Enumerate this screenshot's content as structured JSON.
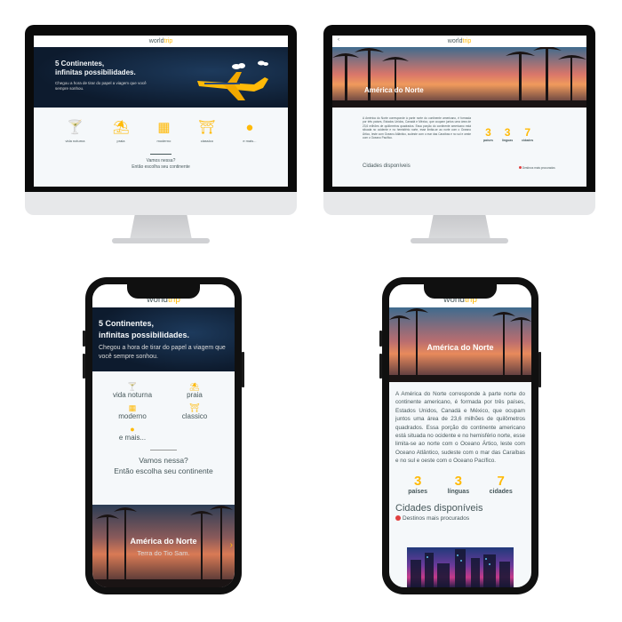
{
  "brand": {
    "logo_main": "world",
    "logo_accent": "trip",
    "accent_color": "#ffba08",
    "text_color": "#47585b",
    "bg_color": "#f5f8fa"
  },
  "banner": {
    "heading_line1": "5 Continentes,",
    "heading_line2": "infinitas possibilidades.",
    "subtitle": "Chegou a hora de tirar do papel a viagem que você sempre sonhou."
  },
  "travel_types": [
    {
      "label": "vida noturna",
      "icon": "cocktail-icon"
    },
    {
      "label": "praia",
      "icon": "beach-icon"
    },
    {
      "label": "moderno",
      "icon": "building-icon"
    },
    {
      "label": "classico",
      "icon": "museum-icon"
    },
    {
      "label": "e mais...",
      "icon": "earth-icon"
    }
  ],
  "cta": {
    "line1": "Vamos nessa?",
    "line2": "Então escolha seu continente"
  },
  "continent_card": {
    "name": "América do Norte",
    "subtitle": "Terra do Tio Sam."
  },
  "continent_page": {
    "name": "América do Norte",
    "description": "A América do Norte corresponde à parte norte do continente americano, é formada por três países, Estados Unidos, Canadá e México, que ocupam juntos uma área de 23,6 milhões de quilômetros quadrados. Essa porção do continente americano está situada no ocidente e no hemisfério norte, esse limita-se ao norte com o Oceano Ártico, leste com Oceano Atlântico, sudeste com o mar das Caraíbas e no sul e oeste com o Oceano Pacífico.",
    "stats": [
      {
        "value": "3",
        "label": "países"
      },
      {
        "value": "3",
        "label": "línguas"
      },
      {
        "value": "7",
        "label": "cidades"
      }
    ],
    "cities_title": "Cidades disponíveis",
    "popular_label": "Destinos mais procurados"
  }
}
